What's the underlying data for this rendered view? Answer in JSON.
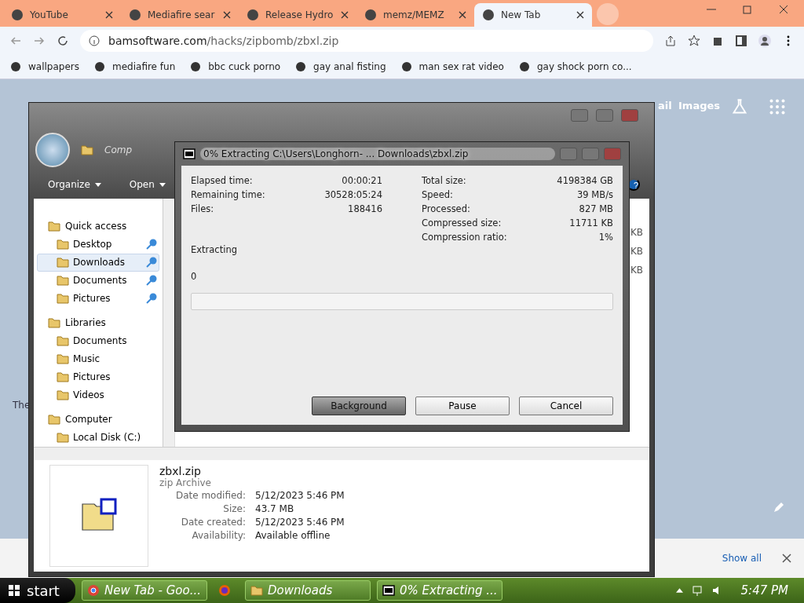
{
  "browser": {
    "tabs": [
      {
        "title": "YouTube",
        "selected": false
      },
      {
        "title": "Mediafire sear",
        "selected": false
      },
      {
        "title": "Release Hydro",
        "selected": false
      },
      {
        "title": "memz/MEMZ",
        "selected": false
      },
      {
        "title": "New Tab",
        "selected": true
      }
    ],
    "address": {
      "host": "bamsoftware.com",
      "path": "/hacks/zipbomb/zbxl.zip"
    },
    "bookmarks": [
      "wallpapers",
      "mediafire fun",
      "bbc cuck porno",
      "gay anal fisting",
      "man sex rat video",
      "gay shock porn co..."
    ],
    "page": {
      "links": [
        "ail",
        "Images"
      ],
      "side_text": "The"
    },
    "download_bar": {
      "show_all": "Show all"
    }
  },
  "explorer": {
    "breadcrumb": "Comp",
    "help": "?",
    "toolbar": [
      "Organize",
      "Open"
    ],
    "sidebar": [
      {
        "label": "Quick access",
        "children": [
          {
            "label": "Desktop",
            "pinned": true,
            "selected": false
          },
          {
            "label": "Downloads",
            "pinned": true,
            "selected": true
          },
          {
            "label": "Documents",
            "pinned": true,
            "selected": false
          },
          {
            "label": "Pictures",
            "pinned": true,
            "selected": false
          }
        ]
      },
      {
        "label": "Libraries",
        "children": [
          {
            "label": "Documents",
            "pinned": false,
            "selected": false
          },
          {
            "label": "Music",
            "pinned": false,
            "selected": false
          },
          {
            "label": "Pictures",
            "pinned": false,
            "selected": false
          },
          {
            "label": "Videos",
            "pinned": false,
            "selected": false
          }
        ]
      },
      {
        "label": "Computer",
        "children": [
          {
            "label": "Local Disk (C:)",
            "pinned": false,
            "selected": false
          }
        ]
      }
    ],
    "list_sizes": [
      "KB",
      "KB",
      "KB"
    ],
    "details": {
      "name": "zbxl.zip",
      "type": "zip Archive",
      "fields": [
        {
          "label": "Date modified:",
          "value": "5/12/2023 5:46 PM"
        },
        {
          "label": "Size:",
          "value": "43.7 MB"
        },
        {
          "label": "Date created:",
          "value": "5/12/2023 5:46 PM"
        },
        {
          "label": "Availability:",
          "value": "Available offline"
        }
      ]
    }
  },
  "dialog": {
    "title": "0% Extracting C:\\Users\\Longhorn- ... Downloads\\zbxl.zip",
    "left_stats": [
      {
        "label": "Elapsed time:",
        "value": "00:00:21"
      },
      {
        "label": "Remaining time:",
        "value": "30528:05:24"
      },
      {
        "label": "Files:",
        "value": "188416"
      }
    ],
    "right_stats": [
      {
        "label": "Total size:",
        "value": "4198384 GB"
      },
      {
        "label": "Speed:",
        "value": "39 MB/s"
      },
      {
        "label": "Processed:",
        "value": "827 MB"
      },
      {
        "label": "Compressed size:",
        "value": "11711 KB"
      },
      {
        "label": "Compression ratio:",
        "value": "1%"
      }
    ],
    "status": "Extracting",
    "current_file": "0",
    "progress": {
      "level": 0
    },
    "buttons": [
      {
        "label": "Background",
        "selected": true
      },
      {
        "label": "Pause",
        "selected": false
      },
      {
        "label": "Cancel",
        "selected": false
      }
    ]
  },
  "taskbar": {
    "start": "start",
    "items": [
      {
        "kind": "chrome",
        "label": "New Tab - Goo..."
      },
      {
        "kind": "firefox"
      },
      {
        "kind": "folder",
        "label": "Downloads"
      },
      {
        "kind": "sevenzip",
        "label": "0% Extracting ..."
      }
    ],
    "clock": "5:47 PM"
  }
}
